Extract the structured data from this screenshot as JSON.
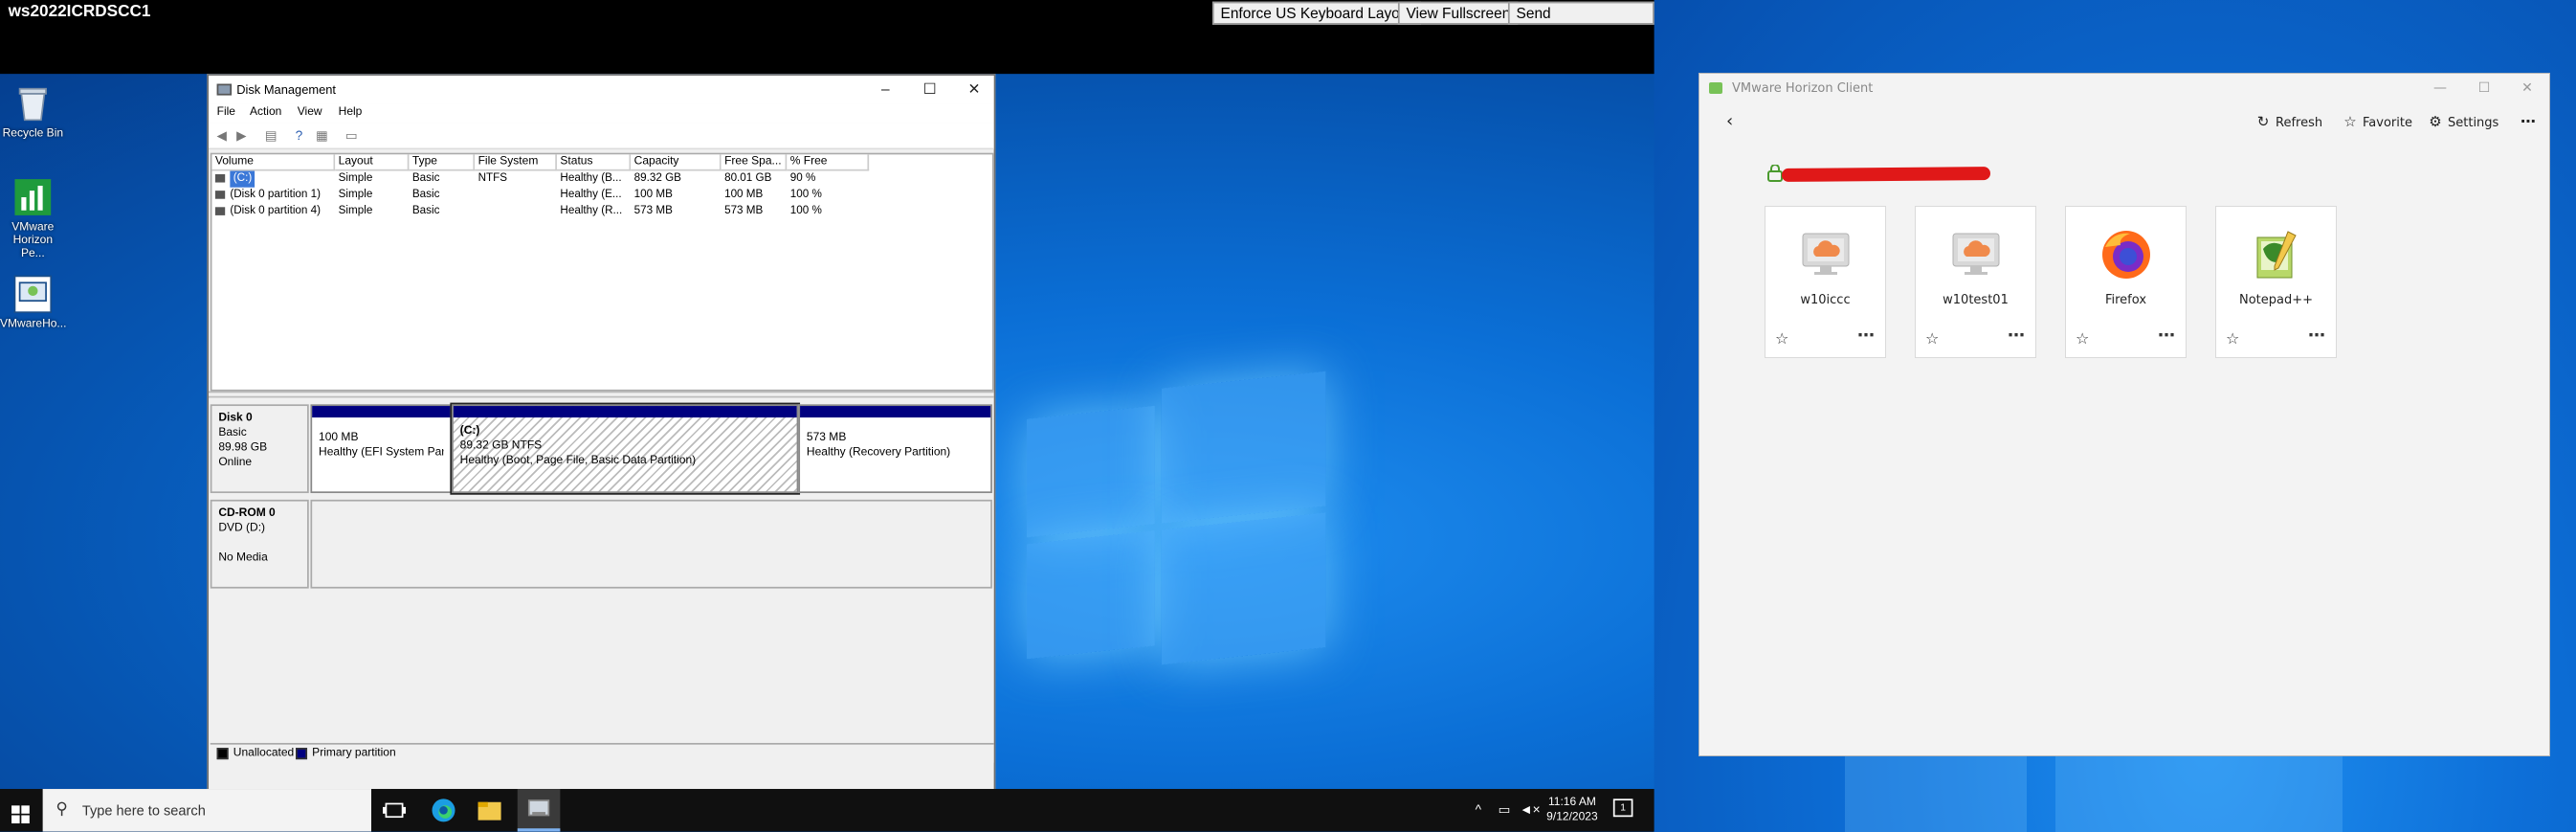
{
  "console": {
    "host_title": "ws2022ICRDSCC1",
    "buttons": [
      "Enforce US Keyboard Layout",
      "View Fullscreen",
      "Send Ctrl+Alt+Delete"
    ]
  },
  "desktop_icons": [
    {
      "label": "Recycle Bin",
      "icon": "recycle-bin-icon"
    },
    {
      "label": "VMware Horizon Pe...",
      "icon": "horizon-performance-icon"
    },
    {
      "label": "VMwareHo...",
      "icon": "horizon-client-shortcut-icon"
    }
  ],
  "disk_mgmt": {
    "title": "Disk Management",
    "menu": [
      "File",
      "Action",
      "View",
      "Help"
    ],
    "columns": [
      "Volume",
      "Layout",
      "Type",
      "File System",
      "Status",
      "Capacity",
      "Free Spa...",
      "% Free"
    ],
    "rows": [
      [
        "(C:)",
        "Simple",
        "Basic",
        "NTFS",
        "Healthy (B...",
        "89.32 GB",
        "80.01 GB",
        "90 %"
      ],
      [
        "(Disk 0 partition 1)",
        "Simple",
        "Basic",
        "",
        "Healthy (E...",
        "100 MB",
        "100 MB",
        "100 %"
      ],
      [
        "(Disk 0 partition 4)",
        "Simple",
        "Basic",
        "",
        "Healthy (R...",
        "573 MB",
        "573 MB",
        "100 %"
      ]
    ],
    "disk0": {
      "name": "Disk 0",
      "type": "Basic",
      "size": "89.98 GB",
      "state": "Online"
    },
    "partitions": [
      {
        "size": "100 MB",
        "status": "Healthy (EFI System Parti"
      },
      {
        "label": "(C:)",
        "size": "89.32 GB NTFS",
        "status": "Healthy (Boot, Page File, Basic Data Partition)"
      },
      {
        "size": "573 MB",
        "status": "Healthy (Recovery Partition)"
      }
    ],
    "cdrom": {
      "name": "CD-ROM 0",
      "type": "DVD (D:)",
      "media": "No Media"
    },
    "legend": [
      "Unallocated",
      "Primary partition"
    ]
  },
  "taskbar": {
    "search_placeholder": "Type here to search",
    "time": "11:16 AM",
    "date": "9/12/2023"
  },
  "horizon": {
    "title": "VMware Horizon Client",
    "toolbar": {
      "refresh": "Refresh",
      "favorite": "Favorite",
      "settings": "Settings"
    },
    "tiles": [
      {
        "name": "w10iccc",
        "icon": "desktop-cloud-icon"
      },
      {
        "name": "w10test01",
        "icon": "desktop-cloud-icon"
      },
      {
        "name": "Firefox",
        "icon": "firefox-icon"
      },
      {
        "name": "Notepad++",
        "icon": "notepad-plus-plus-icon"
      }
    ]
  },
  "colors": {
    "partition_header": "#000080",
    "console_bar": "#000000",
    "desktop_blue": "#0b6fd6",
    "redaction": "#e01818"
  }
}
